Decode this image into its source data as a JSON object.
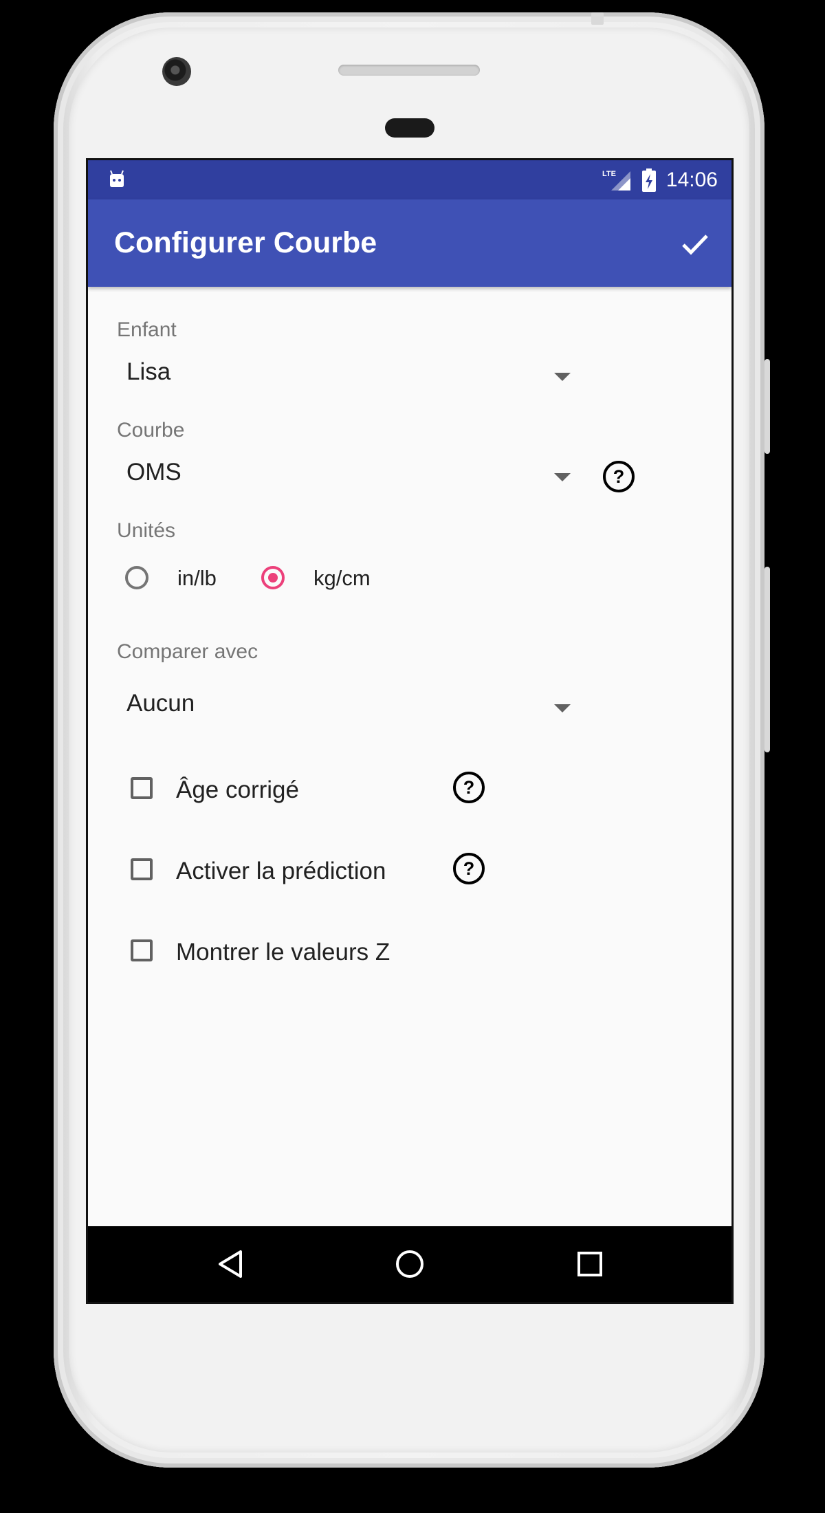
{
  "status_bar": {
    "network": "LTE",
    "time": "14:06"
  },
  "app_bar": {
    "title": "Configurer Courbe",
    "confirm_icon": "check-icon"
  },
  "form": {
    "enfant": {
      "label": "Enfant",
      "value": "Lisa"
    },
    "courbe": {
      "label": "Courbe",
      "value": "OMS"
    },
    "unites": {
      "label": "Unités",
      "options": [
        {
          "label": "in/lb",
          "selected": false
        },
        {
          "label": "kg/cm",
          "selected": true
        }
      ]
    },
    "comparer": {
      "label": "Comparer avec",
      "value": "Aucun"
    },
    "checkboxes": [
      {
        "label": "Âge corrigé",
        "checked": false,
        "help": true
      },
      {
        "label": "Activer la prédiction",
        "checked": false,
        "help": true
      },
      {
        "label": "Montrer le valeurs Z",
        "checked": false,
        "help": false
      }
    ]
  },
  "nav_bar": {
    "icons": [
      "back-icon",
      "home-icon",
      "recents-icon"
    ]
  },
  "colors": {
    "status_bar": "#303f9f",
    "app_bar": "#3f51b5",
    "accent": "#ec407a"
  }
}
